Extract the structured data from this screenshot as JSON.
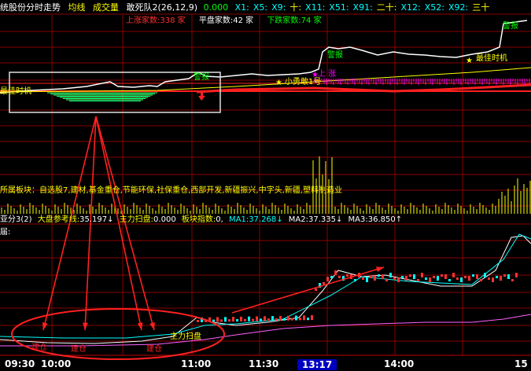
{
  "colors": {
    "bg": "#000000",
    "red": "#ff2020",
    "grid": "#a00000",
    "green": "#00d000",
    "yellow": "#ffff00",
    "magenta": "#ff00ff",
    "cyan": "#00c0c0",
    "white": "#ffffff"
  },
  "header": {
    "title": "统股份分时走势",
    "toggle_avg": "均线",
    "toggle_volume": "成交量",
    "indicator_name": "敢死队2",
    "indicator_params": "(26,12,9)",
    "indicator_value": "0.000",
    "ma_items": [
      {
        "label": "X1:",
        "value": "",
        "color": "#00ffff"
      },
      {
        "label": "X5:",
        "value": "",
        "color": "#00ffff"
      },
      {
        "label": "X9:",
        "value": "",
        "color": "#00ffff"
      },
      {
        "label": "十:",
        "value": "",
        "color": "#ffff00"
      },
      {
        "label": "X11:",
        "value": "",
        "color": "#00ffff"
      },
      {
        "label": "X51:",
        "value": "",
        "color": "#00ffff"
      },
      {
        "label": "X91:",
        "value": "",
        "color": "#00ffff"
      },
      {
        "label": "二十:",
        "value": "",
        "color": "#ffff00"
      },
      {
        "label": "X12:",
        "value": "",
        "color": "#00ffff"
      },
      {
        "label": "X52:",
        "value": "",
        "color": "#00ffff"
      },
      {
        "label": "X92:",
        "value": "",
        "color": "#00ffff"
      },
      {
        "label": "三十",
        "value": "",
        "color": "#ffff00"
      }
    ]
  },
  "breadth": {
    "up_label": "上涨家数:338",
    "up_unit": "家",
    "flat_label": "平盘家数:42",
    "flat_unit": "家",
    "down_label": "下跌家数:74",
    "down_unit": "家"
  },
  "annotations": {
    "alarm1": "警报",
    "alarm2": "警报",
    "alarm3": "警报",
    "best_time_left": "最佳时机",
    "best_time_right": "最佳时机",
    "small_brave": "小勇敢1号",
    "shang_qi": "上 涨",
    "main_sweep": "主力扫盘",
    "jian_cang_1": "建仓",
    "jian_cang_2": "建仓",
    "jian_cang_3": "建仓"
  },
  "sector_text": "所属板块：自选股7,建材,基金重仓,节能环保,社保重仓,西部开发,新疆振兴,中字头,新疆,塑料制造业",
  "indicator_row": {
    "prefix": "亚分3(2)",
    "ref_label": "大盘参考线:",
    "ref_value": "35.197",
    "sweep_label": "主力扫盘:",
    "sweep_value": "0.000",
    "sector_idx_label": "板块指数:",
    "sector_idx_value": "0,",
    "ma1_label": "MA1:",
    "ma1_value": "37.268",
    "ma2_label": "MA2:",
    "ma2_value": "37.335",
    "ma3_label": "MA3:",
    "ma3_value": "36.850"
  },
  "sub_label": "届:",
  "time_axis": {
    "labels": [
      "09:30",
      "10:00",
      "11:00",
      "11:30",
      "13:17",
      "14:00",
      "15"
    ],
    "highlighted": "13:17"
  }
}
